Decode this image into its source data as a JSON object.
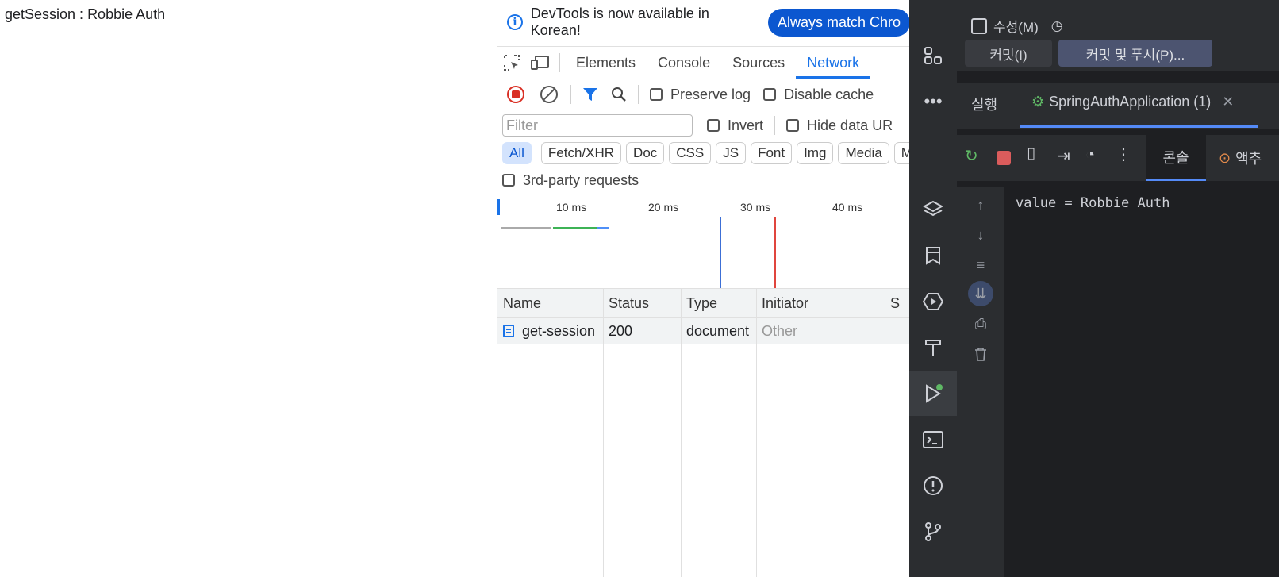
{
  "page": {
    "text": "getSession : Robbie Auth"
  },
  "devtools": {
    "banner": {
      "text": "DevTools is now available in Korean!",
      "button": "Always match Chro"
    },
    "tabs": [
      "Elements",
      "Console",
      "Sources",
      "Network"
    ],
    "active_tab": "Network",
    "toolbar": {
      "preserve_log": "Preserve log",
      "disable_cache": "Disable cache"
    },
    "filter": {
      "placeholder": "Filter",
      "invert": "Invert",
      "hide_data_urls": "Hide data UR"
    },
    "types": [
      "All",
      "Fetch/XHR",
      "Doc",
      "CSS",
      "JS",
      "Font",
      "Img",
      "Media",
      "Ma"
    ],
    "third_party": "3rd-party requests",
    "timeline": {
      "labels": [
        "10 ms",
        "20 ms",
        "30 ms",
        "40 ms"
      ]
    },
    "table": {
      "headers": [
        "Name",
        "Status",
        "Type",
        "Initiator",
        "S"
      ],
      "rows": [
        {
          "name": "get-session",
          "status": "200",
          "type": "document",
          "initiator": "Other"
        }
      ]
    }
  },
  "ide": {
    "top": {
      "modify": "수성(M)",
      "commit": "커밋(I)",
      "commit_push": "커밋 및 푸시(P)..."
    },
    "run": {
      "label": "실행",
      "config": "SpringAuthApplication (1)"
    },
    "tools": {
      "console_tab": "콘솔",
      "actuator_tab": "액추"
    },
    "console_output": "value = Robbie Auth",
    "colors": {
      "bg": "#1e1f22",
      "panel": "#2b2d30",
      "accent": "#548af7"
    }
  }
}
